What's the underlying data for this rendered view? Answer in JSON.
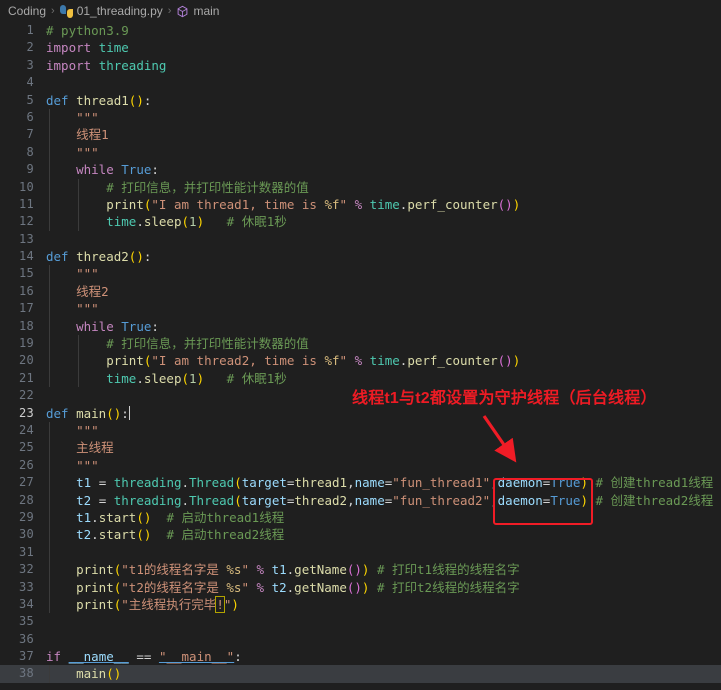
{
  "window": {
    "app": "vscode-editor",
    "background": "#1f1f1f"
  },
  "breadcrumb": {
    "name": "breadcrumb",
    "items": [
      {
        "label": "Coding",
        "icon": ""
      },
      {
        "label": "01_threading.py",
        "icon": "python-file-icon"
      },
      {
        "label": "main",
        "icon": "symbol-method-icon"
      }
    ],
    "separator": "›"
  },
  "editor": {
    "language": "python",
    "active_line": 23,
    "cursor_column": 12,
    "lines": [
      {
        "n": 1,
        "text": "# python3.9"
      },
      {
        "n": 2,
        "text": "import time"
      },
      {
        "n": 3,
        "text": "import threading"
      },
      {
        "n": 4,
        "text": ""
      },
      {
        "n": 5,
        "text": "def thread1():"
      },
      {
        "n": 6,
        "text": "    \"\"\""
      },
      {
        "n": 7,
        "text": "    线程1"
      },
      {
        "n": 8,
        "text": "    \"\"\""
      },
      {
        "n": 9,
        "text": "    while True:"
      },
      {
        "n": 10,
        "text": "        # 打印信息，并打印性能计数器的值"
      },
      {
        "n": 11,
        "text": "        print(\"I am thread1, time is %f\" % time.perf_counter())"
      },
      {
        "n": 12,
        "text": "        time.sleep(1)   # 休眠1秒"
      },
      {
        "n": 13,
        "text": ""
      },
      {
        "n": 14,
        "text": "def thread2():"
      },
      {
        "n": 15,
        "text": "    \"\"\""
      },
      {
        "n": 16,
        "text": "    线程2"
      },
      {
        "n": 17,
        "text": "    \"\"\""
      },
      {
        "n": 18,
        "text": "    while True:"
      },
      {
        "n": 19,
        "text": "        # 打印信息，并打印性能计数器的值"
      },
      {
        "n": 20,
        "text": "        print(\"I am thread2, time is %f\" % time.perf_counter())"
      },
      {
        "n": 21,
        "text": "        time.sleep(1)   # 休眠1秒"
      },
      {
        "n": 22,
        "text": ""
      },
      {
        "n": 23,
        "text": "def main():"
      },
      {
        "n": 24,
        "text": "    \"\"\""
      },
      {
        "n": 25,
        "text": "    主线程"
      },
      {
        "n": 26,
        "text": "    \"\"\""
      },
      {
        "n": 27,
        "text": "    t1 = threading.Thread(target=thread1,name=\"fun_thread1\",daemon=True) # 创建thread1线程"
      },
      {
        "n": 28,
        "text": "    t2 = threading.Thread(target=thread2,name=\"fun_thread2\",daemon=True) # 创建thread2线程"
      },
      {
        "n": 29,
        "text": "    t1.start()  # 启动thread1线程"
      },
      {
        "n": 30,
        "text": "    t2.start()  # 启动thread2线程"
      },
      {
        "n": 31,
        "text": ""
      },
      {
        "n": 32,
        "text": "    print(\"t1的线程名字是 %s\" % t1.getName()) # 打印t1线程的线程名字"
      },
      {
        "n": 33,
        "text": "    print(\"t2的线程名字是 %s\" % t2.getName()) # 打印t2线程的线程名字"
      },
      {
        "n": 34,
        "text": "    print(\"主线程执行完毕!\")"
      },
      {
        "n": 35,
        "text": ""
      },
      {
        "n": 36,
        "text": ""
      },
      {
        "n": 37,
        "text": "if __name__ == \"__main__\":"
      },
      {
        "n": 38,
        "text": "    main()"
      }
    ],
    "fragments": {
      "l1_comment": "# python3.9",
      "kw_import": "import",
      "mod_time": "time",
      "mod_threading": "threading",
      "kw_def": "def",
      "fn_thread1": "thread1",
      "fn_thread2": "thread2",
      "fn_main": "main",
      "docquote": "\"\"\"",
      "doc_thread1": "线程1",
      "doc_thread2": "线程2",
      "doc_main": "主线程",
      "kw_while": "while",
      "kw_true": "True",
      "comment_print_info": "# 打印信息，并打印性能计数器的值",
      "fn_print": "print",
      "str_thread1_msg": "\"I am thread1, time is ",
      "str_thread2_msg": "\"I am thread2, time is ",
      "fmt_f": "%f",
      "fmt_s": "%s",
      "str_close": "\"",
      "op_percent": "%",
      "mod_time_dot": "time",
      "fn_perf_counter": "perf_counter",
      "fn_sleep": "sleep",
      "num_1": "1",
      "comment_sleep1": "# 休眠1秒",
      "var_t1": "t1",
      "var_t2": "t2",
      "op_eq": "=",
      "cls_Thread": "Thread",
      "kwarg_target": "target",
      "kwarg_name": "name",
      "kwarg_daemon": "daemon",
      "str_fun_thread1": "\"fun_thread1\"",
      "str_fun_thread2": "\"fun_thread2\"",
      "comment_create1": "# 创建thread1线程",
      "comment_create2": "# 创建thread2线程",
      "fn_start": "start",
      "comment_start1": "# 启动thread1线程",
      "comment_start2": "# 启动thread2线程",
      "str_t1_name": "\"t1的线程名字是 ",
      "str_t2_name": "\"t2的线程名字是 ",
      "fn_getName": "getName",
      "comment_printname1": "# 打印t1线程的线程名字",
      "comment_printname2": "# 打印t2线程的线程名字",
      "str_main_done": "\"主线程执行完毕",
      "bang": "!",
      "kw_if": "if",
      "dunder_name": "__name__",
      "op_eqeq": "==",
      "str_dunder_main": "\"__main__\"",
      "colon": ":",
      "call_main": "main"
    }
  },
  "annotation": {
    "name": "red-annotation",
    "text": "线程t1与t2都设置为守护线程（后台线程）",
    "color": "#ee1b24",
    "arrow": "down-right-arrow",
    "highlight_target": "daemon=True)"
  },
  "colors": {
    "background": "#1f1f1f",
    "line_number": "#6e7681",
    "line_number_active": "#cfcfcf",
    "keyword": "#c586c0",
    "keyword_blue": "#569cd6",
    "function": "#dcdcaa",
    "variable": "#9cdcfe",
    "string": "#ce9178",
    "comment": "#6a9955",
    "number": "#b5cea8",
    "class": "#4ec9b0",
    "bracket1": "#ffd700",
    "bracket2": "#da70d6",
    "annotation_red": "#ee1b24"
  }
}
